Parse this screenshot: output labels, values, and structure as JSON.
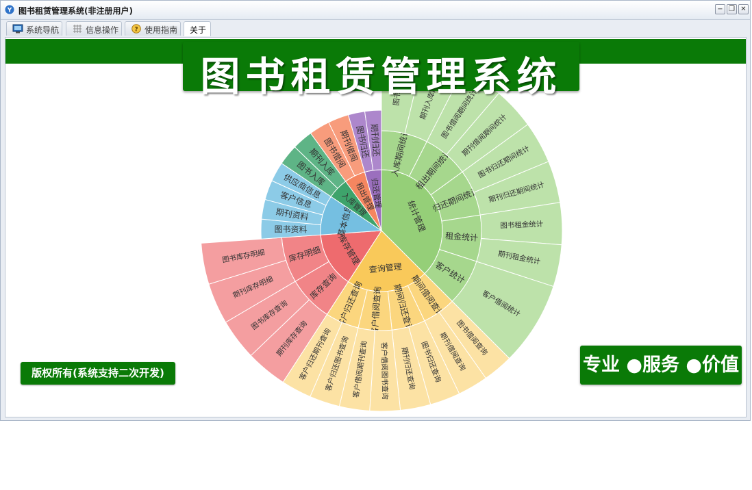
{
  "window": {
    "title": "图书租赁管理系统(非注册用户)"
  },
  "window_controls": {
    "minimize": "−",
    "restore": "❐",
    "close": "✕"
  },
  "tabs": [
    {
      "label": "系统导航",
      "icon": "monitor-icon",
      "active": false
    },
    {
      "label": "信息操作",
      "icon": "grid-icon",
      "active": false
    },
    {
      "label": "使用指南",
      "icon": "help-icon",
      "active": false
    },
    {
      "label": "关于",
      "icon": "",
      "active": true
    }
  ],
  "banner": {
    "title": "图书租赁管理系统"
  },
  "copyright": {
    "text": "版权所有(系统支持二次开发)"
  },
  "slogan": {
    "text": "专业 ●服务 ●价值"
  },
  "colors": {
    "brand_green": "#0a7a07",
    "stats": [
      "#95cf78",
      "#a6d78d",
      "#bde2aa"
    ],
    "query": [
      "#f9c95a",
      "#fbd67e",
      "#fce2a4"
    ],
    "inventory": [
      "#ee6b6e",
      "#f18487",
      "#f49ea0"
    ],
    "basic": [
      "#75bfe1",
      "#8ccbe7",
      "#a3d6ee"
    ],
    "stock_in": [
      "#3ea36b",
      "#5eb486",
      "#7bc39c"
    ],
    "rent": [
      "#f58660",
      "#f89c7c",
      "#fab39a"
    ],
    "return": [
      "#9b6fbe",
      "#ad87cc",
      "#bf9fd8"
    ]
  },
  "chart_data": {
    "type": "sunburst",
    "categories": [
      {
        "name": "统计管理",
        "children": [
          {
            "name": "入库期间统计",
            "children": [
              {
                "name": "图书入库"
              },
              {
                "name": "期刊入库期间"
              }
            ]
          },
          {
            "name": "租出期间统计",
            "children": [
              {
                "name": "图书借阅期间统计"
              },
              {
                "name": "期刊借阅期间统计"
              }
            ]
          },
          {
            "name": "归还期间统计",
            "children": [
              {
                "name": "图书归还期间统计"
              },
              {
                "name": "期刊归还期间统计"
              }
            ]
          },
          {
            "name": "租金统计",
            "children": [
              {
                "name": "图书租金统计"
              },
              {
                "name": "期刊租金统计"
              }
            ]
          },
          {
            "name": "客户统计",
            "children": [
              {
                "name": "客户借阅统计"
              }
            ]
          }
        ]
      },
      {
        "name": "查询管理",
        "children": [
          {
            "name": "期间借阅查询",
            "children": [
              {
                "name": "图书借阅查询"
              },
              {
                "name": "期刊借阅查询"
              }
            ]
          },
          {
            "name": "期间归还查询",
            "children": [
              {
                "name": "图书归还查询"
              },
              {
                "name": "期刊归还查询"
              }
            ]
          },
          {
            "name": "客户借阅查询",
            "children": [
              {
                "name": "客户借阅图书查询"
              },
              {
                "name": "客户借阅期刊查询"
              }
            ]
          },
          {
            "name": "客户归还查询",
            "children": [
              {
                "name": "客户归还图书查询"
              },
              {
                "name": "客户归还期刊查询"
              }
            ]
          }
        ]
      },
      {
        "name": "库存管理",
        "children": [
          {
            "name": "库存查询",
            "children": [
              {
                "name": "期刊库存查询"
              },
              {
                "name": "图书库存查询"
              }
            ]
          },
          {
            "name": "库存明细",
            "children": [
              {
                "name": "期刊库存明细"
              },
              {
                "name": "图书库存明细"
              }
            ]
          }
        ]
      },
      {
        "name": "基本信息",
        "children": [
          {
            "name": "图书资料"
          },
          {
            "name": "期刊资料"
          },
          {
            "name": "客户信息"
          },
          {
            "name": "供应商信息"
          }
        ]
      },
      {
        "name": "入库管理",
        "children": [
          {
            "name": "图书入库"
          },
          {
            "name": "期刊入库"
          }
        ]
      },
      {
        "name": "租出管理",
        "children": [
          {
            "name": "图书借阅"
          },
          {
            "name": "期刊借阅"
          }
        ]
      },
      {
        "name": "归还管理",
        "children": [
          {
            "name": "图书归还"
          },
          {
            "name": "期刊归还"
          }
        ]
      }
    ]
  }
}
